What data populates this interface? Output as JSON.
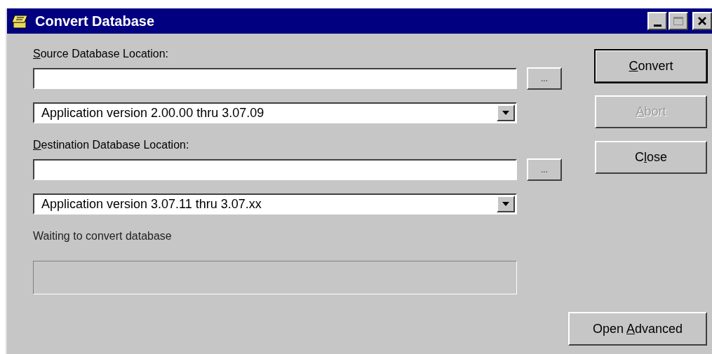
{
  "window": {
    "title": "Convert Database",
    "controls": [
      {
        "kind": "minimize"
      },
      {
        "kind": "maximize",
        "disabled": true
      },
      {
        "kind": "close"
      }
    ]
  },
  "source": {
    "label": {
      "key": "S",
      "after": "ource Database Location:"
    },
    "browse": "...",
    "version": "Application version 2.00.00 thru 3.07.09"
  },
  "destination": {
    "label": {
      "key": "D",
      "after": "estination Database Location:"
    },
    "browse": "...",
    "version": "Application version 3.07.11 thru 3.07.xx"
  },
  "status": {
    "text": "Waiting to convert database"
  },
  "buttons": [
    {
      "key": "C",
      "after": "onvert",
      "default": true,
      "disabled": false
    },
    {
      "key": "A",
      "after": "bort",
      "default": false,
      "disabled": true
    },
    {
      "before": "C",
      "key": "l",
      "after": "ose",
      "default": false,
      "disabled": false
    }
  ],
  "advanced": {
    "before": "Open ",
    "key": "A",
    "after": "dvanced"
  }
}
